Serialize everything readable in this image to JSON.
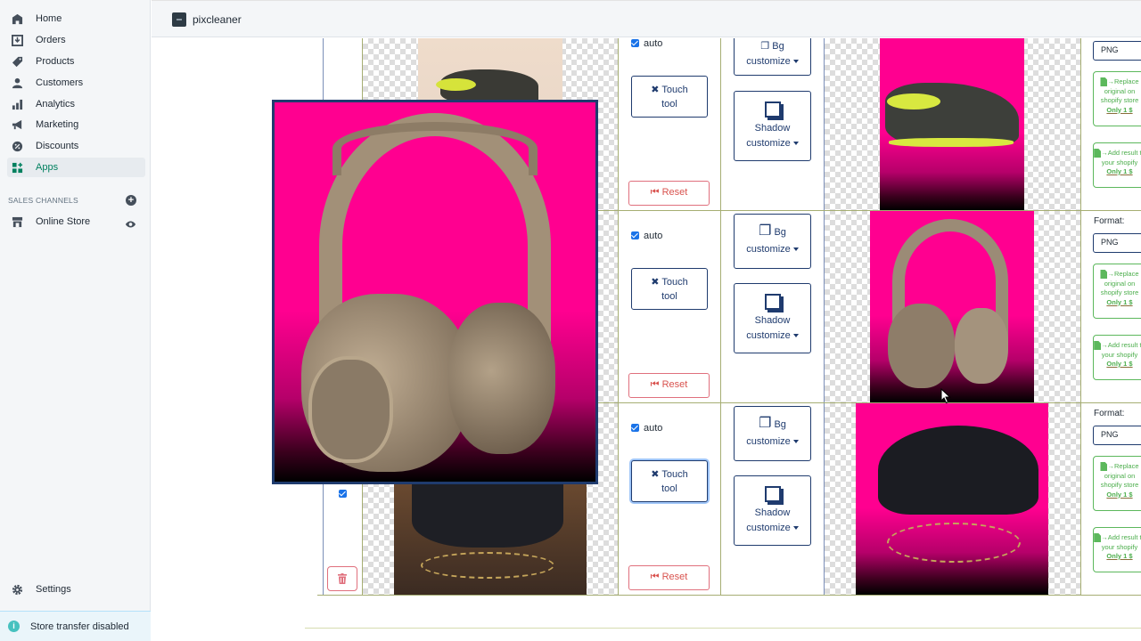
{
  "app": {
    "name": "pixcleaner"
  },
  "sidebar": {
    "items": [
      {
        "label": "Home",
        "icon": "home-icon"
      },
      {
        "label": "Orders",
        "icon": "orders-icon"
      },
      {
        "label": "Products",
        "icon": "tag-icon"
      },
      {
        "label": "Customers",
        "icon": "person-icon"
      },
      {
        "label": "Analytics",
        "icon": "bar-chart-icon"
      },
      {
        "label": "Marketing",
        "icon": "megaphone-icon"
      },
      {
        "label": "Discounts",
        "icon": "discount-icon"
      },
      {
        "label": "Apps",
        "icon": "apps-icon",
        "active": true
      }
    ],
    "sales_channels_title": "SALES CHANNELS",
    "online_store": "Online Store",
    "settings": "Settings",
    "store_transfer": "Store transfer disabled"
  },
  "rows": [
    {
      "product": "sneaker",
      "selected": true,
      "auto_checked": true,
      "auto_label": "auto",
      "touch_tool_label_1": "Touch",
      "touch_tool_label_2": "tool",
      "reset_label": "Reset",
      "bg_label_1": "Bg",
      "bg_label_2": "customize",
      "shadow_label_1": "Shadow",
      "shadow_label_2": "customize",
      "format_label": "",
      "format_value": "PNG",
      "replace_btn": {
        "line1": "Replace",
        "line2": "original on",
        "line3": "shopify store",
        "price": "Only 1 $"
      },
      "add_btn": {
        "line1": "Add result to",
        "line2": "your shopify",
        "price": "Only 1 $"
      }
    },
    {
      "product": "headphones",
      "auto_checked": true,
      "auto_label": "auto",
      "touch_tool_label_1": "Touch",
      "touch_tool_label_2": "tool",
      "reset_label": "Reset",
      "bg_label_1": "Bg",
      "bg_label_2": "customize",
      "shadow_label_1": "Shadow",
      "shadow_label_2": "customize",
      "format_label": "Format:",
      "format_value": "PNG",
      "replace_btn": {
        "line1": "Replace",
        "line2": "original on",
        "line3": "shopify store",
        "price": "Only 1 $"
      },
      "add_btn": {
        "line1": "Add result to",
        "line2": "your shopify",
        "price": "Only 1 $"
      }
    },
    {
      "product": "handbag",
      "selected": true,
      "auto_checked": true,
      "auto_label": "auto",
      "touch_tool_label_1": "Touch",
      "touch_tool_label_2": "tool",
      "reset_label": "Reset",
      "bg_label_1": "Bg",
      "bg_label_2": "customize",
      "shadow_label_1": "Shadow",
      "shadow_label_2": "customize",
      "format_label": "Format:",
      "format_value": "PNG",
      "replace_btn": {
        "line1": "Replace",
        "line2": "original on",
        "line3": "shopify store",
        "price": "Only 1 $"
      },
      "add_btn": {
        "line1": "Add result to",
        "line2": "your shopify",
        "price": "Only 1 $"
      }
    }
  ],
  "popup": {
    "subject": "headphones preview"
  },
  "colors": {
    "accent": "#1f3b6e",
    "magenta": "#ff0090",
    "danger": "#d9534f",
    "success": "#5cb85c",
    "apps_active": "#00805f"
  }
}
